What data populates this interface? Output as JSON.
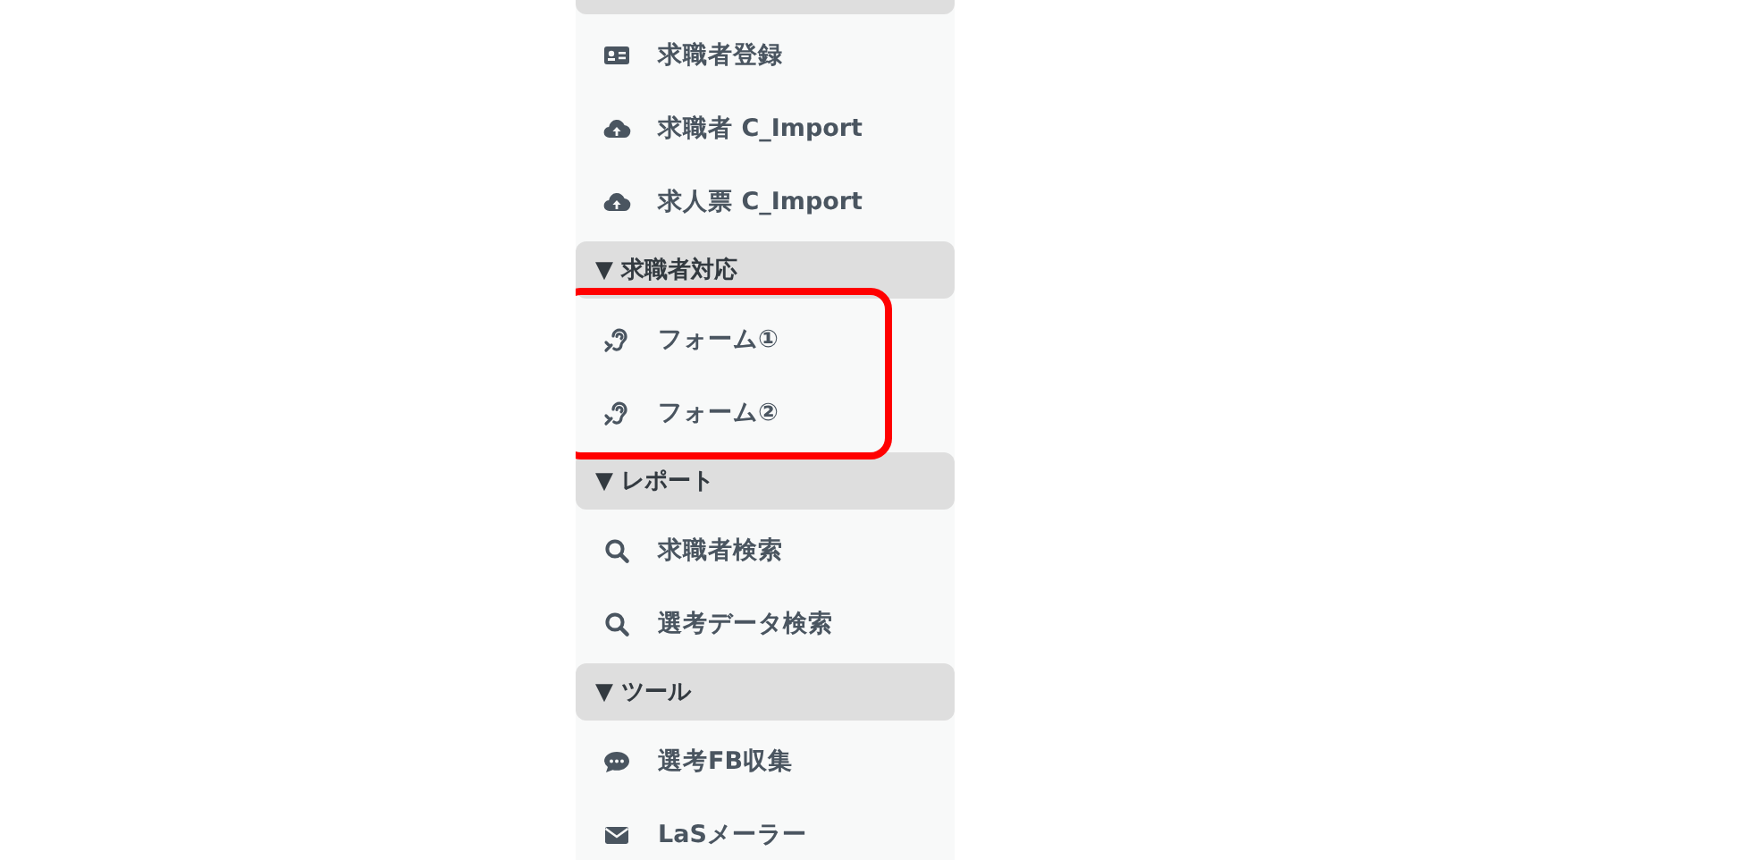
{
  "sections": [
    {
      "highlighted": false,
      "items": [
        {
          "label": "求職者登録",
          "kind": "card"
        },
        {
          "label": "求職者 C_Import",
          "kind": "upload"
        },
        {
          "label": "求人票 C_Import",
          "kind": "upload"
        }
      ]
    },
    {
      "header": "▼ 求職者対応",
      "highlighted": true,
      "items": [
        {
          "label": "フォーム①",
          "kind": "hearing"
        },
        {
          "label": "フォーム②",
          "kind": "hearing"
        }
      ]
    },
    {
      "header": "▼ レポート",
      "highlighted": false,
      "items": [
        {
          "label": "求職者検索",
          "kind": "search"
        },
        {
          "label": "選考データ検索",
          "kind": "search"
        }
      ]
    },
    {
      "header": "▼ ツール",
      "highlighted": false,
      "items": [
        {
          "label": "選考FB収集",
          "kind": "chat"
        },
        {
          "label": "LaSメーラー",
          "kind": "mail"
        }
      ]
    }
  ]
}
